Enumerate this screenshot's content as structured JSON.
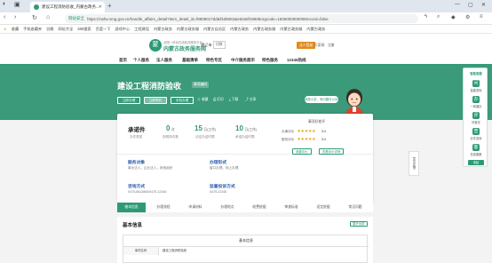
{
  "browser": {
    "tab_title": "建设工程消防验收_内蒙古政务...",
    "url_secure": "网站安全",
    "url": "https://zwfw.nmg.gov.cn/handle_affairs_detail?item_detail_id=f9808017dd&f3d9052&e92a8f19608orgcode=1505000000008record=false"
  },
  "bookmarks": [
    "收藏",
    "手机收藏夹",
    "谷歌",
    "网址大全",
    "360搜索",
    "百度一下",
    "游戏中心",
    "工程建设",
    "内蒙古政务",
    "内蒙古政务服",
    "内蒙古自治区",
    "内蒙古政务",
    "内蒙古政务服",
    "内蒙古政务服",
    "内蒙古政务"
  ],
  "site": {
    "logo_char": "蒙",
    "subtitle": "全国一体化在线政务服务平台",
    "name": "内蒙古政务服务网",
    "region": "通辽市",
    "region_tag": "切换",
    "user_actions": [
      "法人登录",
      "万家网",
      "注册"
    ]
  },
  "nav": [
    "首页",
    "个人服务",
    "法人服务",
    "基础清单",
    "特色专区",
    "中介服务超市",
    "特色服务",
    "12345热线"
  ],
  "banner": {
    "title": "建设工程消防验收",
    "badge": "事项编码",
    "buttons": [
      "立即办理",
      "立即预约",
      "手机办理"
    ],
    "actions": [
      "收藏",
      "打印",
      "下载",
      "分享"
    ],
    "chat": "我是小蒙，有问题可以问我"
  },
  "card": {
    "doc_name": "承诺件",
    "doc_sub": "办件类型",
    "stats": [
      {
        "num": "0",
        "unit": "次",
        "label": "到现场次数"
      },
      {
        "num": "15",
        "unit": "日(工作)",
        "label": "法定办结时限"
      },
      {
        "num": "10",
        "unit": "日(工作)",
        "label": "承诺办结时限"
      }
    ],
    "eval": {
      "title": "事项好差评",
      "rows": [
        {
          "label": "办事评价",
          "stars": "★★★★★",
          "score": "5.0"
        },
        {
          "label": "服务评价",
          "stars": "★★★★★",
          "score": "5.0"
        }
      ],
      "buttons": [
        "我要评价",
        "查看评价详情"
      ]
    },
    "fields": [
      {
        "title": "服务对象",
        "value": "事业法人，企业法人，其他组织"
      },
      {
        "title": "办理形式",
        "value": "窗口办理，网上办理"
      },
      {
        "title": "咨询方式",
        "value": "0475-8812860/0475-12345"
      },
      {
        "title": "监督投诉方式",
        "value": "0475-12345"
      }
    ]
  },
  "tabs": [
    "基本信息",
    "办理流程",
    "申请材料",
    "办理地点",
    "收费依据",
    "审查标准",
    "设定依据",
    "常见问题"
  ],
  "content": {
    "heading": "基本信息",
    "toggle": "展开全部",
    "table_caption": "基本信息",
    "row_key": "事项名称",
    "row_value": "建设工程消防验收"
  },
  "float_tab": "意见反馈",
  "sidebar": {
    "title": "智能客服",
    "items": [
      {
        "icon": "问",
        "label": "智能咨询"
      },
      {
        "icon": "办",
        "label": "一网通办"
      },
      {
        "icon": "评",
        "label": "好差评"
      },
      {
        "icon": "查",
        "label": "办件查询"
      },
      {
        "icon": "客",
        "label": "在线客服"
      }
    ],
    "close": "收起"
  }
}
